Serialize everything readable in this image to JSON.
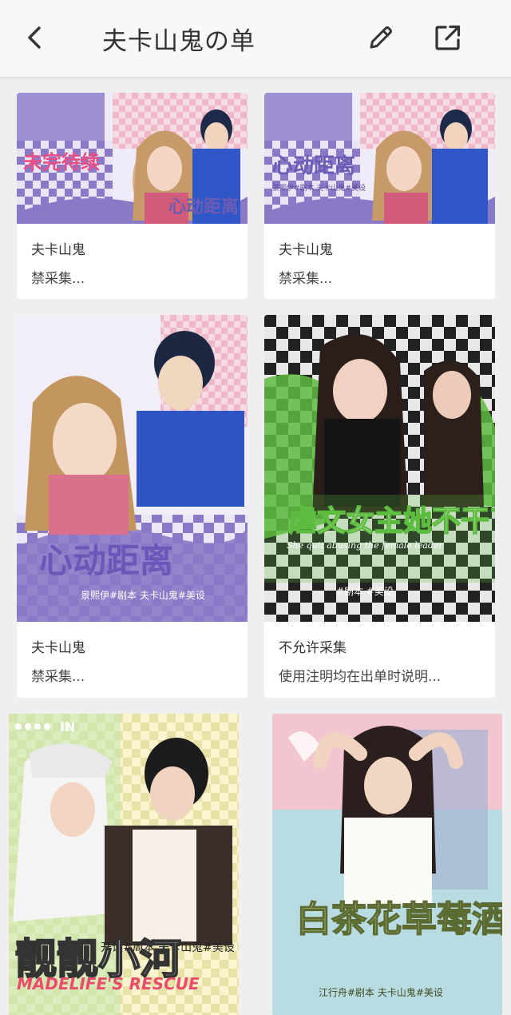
{
  "header": {
    "title": "夫卡山鬼の单",
    "back_icon": "chevron-left-icon",
    "edit_icon": "pencil-icon",
    "share_icon": "share-external-icon"
  },
  "cards": [
    {
      "author": "夫卡山鬼",
      "note": "禁采集...",
      "poster_title": "未完待续",
      "poster_subtitle": "心动距离",
      "accent": "#7b6bb8"
    },
    {
      "author": "夫卡山鬼",
      "note": "禁采集...",
      "poster_title": "心动距离",
      "poster_subtitle": "景熙伊#剧本 夫卡山鬼#美设",
      "accent": "#7b6bb8"
    },
    {
      "author": "夫卡山鬼",
      "note": "禁采集...",
      "poster_title": "心动距离",
      "poster_subtitle": "景熙伊#剧本 夫卡山鬼#美设",
      "accent": "#7b6bb8"
    },
    {
      "author": "不允许采集",
      "note": "使用注明均在出单时说明...",
      "poster_title": "虐文女主她不干了",
      "poster_subtitle": "She quit abusing the female leader",
      "poster_credit": "#剧本 #美设",
      "accent": "#6ec04a"
    },
    {
      "poster_title": "靓靓小河",
      "poster_subtitle": "MADELIFE'S RESCUE",
      "poster_credit": "开设#周本 夫卡山鬼#美设",
      "accent": "#e94c6c"
    },
    {
      "poster_title": "白茶花草莓酒",
      "poster_subtitle": "江行舟#剧本 夫卡山鬼#美设",
      "accent": "#9cb86e"
    }
  ]
}
